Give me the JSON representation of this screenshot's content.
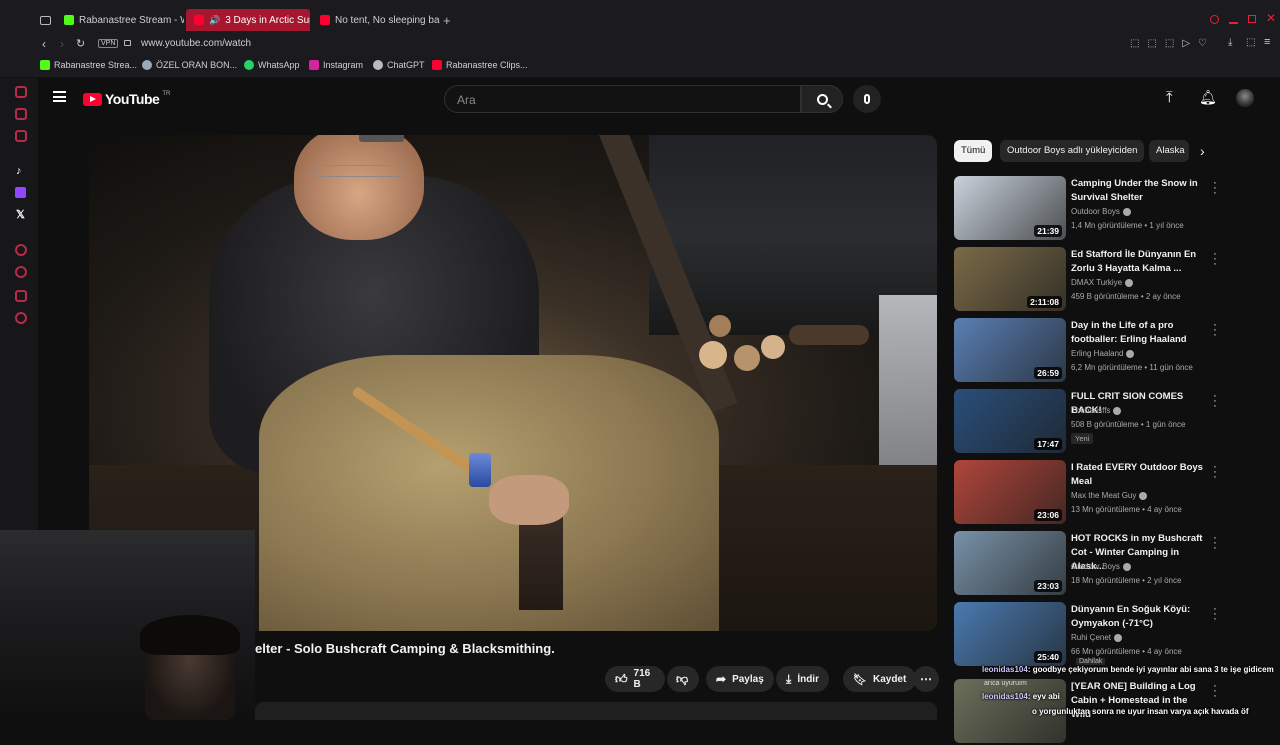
{
  "browser": {
    "tabs": [
      {
        "label": "Rabanastree Stream - Wa",
        "active": false
      },
      {
        "label": "3 Days in Arctic Survi",
        "active": true
      },
      {
        "label": "No tent, No sleeping bag",
        "active": false
      }
    ],
    "url": "www.youtube.com/watch",
    "vpn_label": "VPN",
    "bookmarks": [
      "Rabanastree Strea...",
      "ÖZEL ORAN BON...",
      "WhatsApp",
      "Instagram",
      "ChatGPT",
      "Rabanastree Clips..."
    ]
  },
  "youtube": {
    "logo_text": "YouTube",
    "logo_region": "TR",
    "search_placeholder": "Ara",
    "video_title": "elter - Solo Bushcraft Camping & Blacksmithing.",
    "like_count": "716 B",
    "actions": {
      "share": "Paylaş",
      "download": "İndir",
      "save": "Kaydet"
    },
    "chips": [
      "Tümü",
      "Outdoor Boys adlı yükleyiciden",
      "Alaska"
    ],
    "recommendations": [
      {
        "title": "Camping Under the Snow in Survival Shelter",
        "channel": "Outdoor Boys",
        "verified": true,
        "meta": "1,4 Mn görüntüleme • 1 yıl önce",
        "duration": "21:39",
        "thumb_color": "#c9d2dc",
        "is_new": false
      },
      {
        "title": "Ed Stafford İle Dünyanın En Zorlu 3 Hayatta Kalma ...",
        "channel": "DMAX Turkiye",
        "verified": true,
        "meta": "459 B görüntüleme • 2 ay önce",
        "duration": "2:11:08",
        "thumb_color": "#7a6a48",
        "is_new": false
      },
      {
        "title": "Day in the Life of a pro footballer: Erling Haaland",
        "channel": "Erling Haaland",
        "verified": true,
        "meta": "6,2 Mn görüntüleme • 11 gün önce",
        "duration": "26:59",
        "thumb_color": "#5a7fb4",
        "is_new": false
      },
      {
        "title": "FULL CRIT SION COMES BACK!",
        "channel": "Thebausffs",
        "verified": true,
        "meta": "508 B görüntüleme • 1 gün önce",
        "duration": "17:47",
        "thumb_color": "#2a4f7a",
        "is_new": true,
        "new_label": "Yeni"
      },
      {
        "title": "I Rated EVERY Outdoor Boys Meal",
        "channel": "Max the Meat Guy",
        "verified": true,
        "meta": "13 Mn görüntüleme • 4 ay önce",
        "duration": "23:06",
        "thumb_color": "#b0463a",
        "is_new": false
      },
      {
        "title": "HOT ROCKS in my Bushcraft Cot - Winter Camping in Alask...",
        "channel": "Outdoor Boys",
        "verified": true,
        "meta": "18 Mn görüntüleme • 2 yıl önce",
        "duration": "23:03",
        "thumb_color": "#7892a8",
        "is_new": false
      },
      {
        "title": "Dünyanın En Soğuk Köyü: Oymyakon (-71°C)",
        "channel": "Ruhi Çenet",
        "verified": true,
        "meta": "66 Mn görüntüleme • 4 ay önce",
        "duration": "25:40",
        "thumb_color": "#4a7ab0",
        "is_new": false
      },
      {
        "title": "[YEAR ONE] Building a Log Cabin + Homestead in the Wild",
        "channel": "",
        "verified": false,
        "meta": "",
        "duration": "",
        "thumb_color": "#6b6f5a",
        "is_new": false
      }
    ]
  },
  "overlay": {
    "chat": [
      {
        "user": "leonidas104",
        "text": ": goodbye çekiyorum bende iyi yayınlar abi sana 3 te işe gidicem"
      },
      {
        "user": "leonidas104",
        "text": ": eyv abi"
      },
      {
        "user": "",
        "text": "o yorgunluktan sonra ne uyur insan varya açık havada öf"
      }
    ],
    "popup_fragments": [
      "Dahilak",
      "arıca uyuruım"
    ]
  },
  "colors": {
    "accent": "#ff0033",
    "opera_red": "#a7162f",
    "bg": "#0f0f0f"
  }
}
